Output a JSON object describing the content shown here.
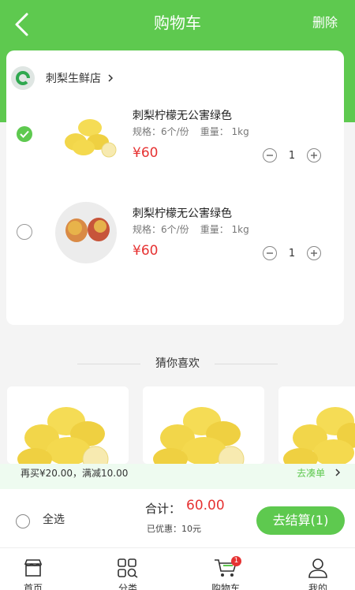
{
  "header": {
    "title": "购物车",
    "delete_label": "删除"
  },
  "store": {
    "name": "刺梨生鲜店"
  },
  "cart_items": [
    {
      "title": "刺梨柠檬无公害绿色",
      "spec": "规格：6个/份",
      "weight": "重量：  1kg",
      "price": "¥60",
      "qty": "1",
      "checked": true
    },
    {
      "title": "刺梨柠檬无公害绿色",
      "spec": "规格：6个/份",
      "weight": "重量：  1kg",
      "price": "¥60",
      "qty": "1",
      "checked": false
    }
  ],
  "recommend": {
    "title": "猜你喜欢"
  },
  "promo": {
    "text": "再买¥20.00，满减10.00",
    "link": "去凑单"
  },
  "checkout": {
    "select_all": "全选",
    "total_label": "合计：",
    "total_value": "60.00",
    "discount": "已优惠：10元",
    "button": "去结算(1)"
  },
  "tabbar": {
    "items": [
      {
        "label": "首页"
      },
      {
        "label": "分类"
      },
      {
        "label": "购物车",
        "badge": "1"
      },
      {
        "label": "我的"
      }
    ]
  },
  "colors": {
    "accent": "#5ec94f",
    "price": "#e63232",
    "icon_store": "store-icon",
    "icon_category": "category-icon",
    "icon_cart": "cart-icon",
    "icon_user": "user-icon"
  }
}
